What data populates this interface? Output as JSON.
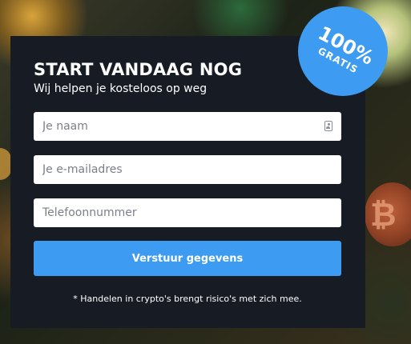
{
  "form": {
    "title": "START VANDAAG NOG",
    "subtitle": "Wij helpen je kosteloos op weg",
    "name_placeholder": "Je naam",
    "email_placeholder": "Je e-mailadres",
    "phone_placeholder": "Telefoonnummer",
    "submit_label": "Verstuur gegevens",
    "disclaimer": "* Handelen in crypto's brengt risico's met zich mee."
  },
  "badge": {
    "percent": "100%",
    "label": "GRATIS"
  },
  "icons": {
    "name_field_icon": "contact-card-icon",
    "background_coin": "bitcoin-icon"
  },
  "colors": {
    "panel_bg": "#171b24",
    "accent_blue": "#3d9bf2",
    "text_white": "#ffffff"
  }
}
